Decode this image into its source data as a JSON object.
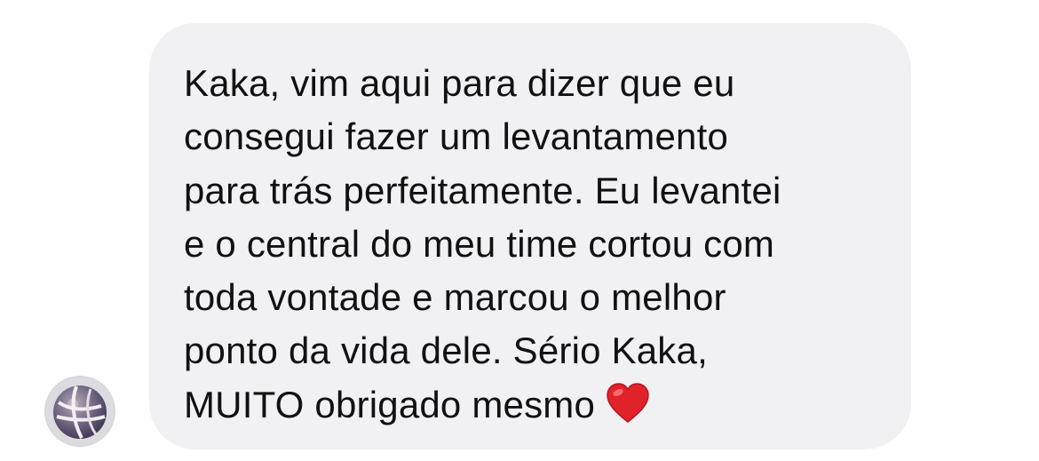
{
  "message": {
    "text": "Kaka, vim aqui para dizer que eu\nconsegui fazer um levantamento\npara trás perfeitamente. Eu levantei\ne o central do meu time cortou com\ntoda vontade e marcou o melhor\nponto da vida dele. Sério Kaka,\nMUITO obrigado mesmo",
    "emoji": "heart-icon"
  },
  "avatar": {
    "icon": "volleyball-icon"
  },
  "colors": {
    "bubble_background": "#f1f1f4",
    "text": "#111111",
    "heart": "#e0222b"
  }
}
